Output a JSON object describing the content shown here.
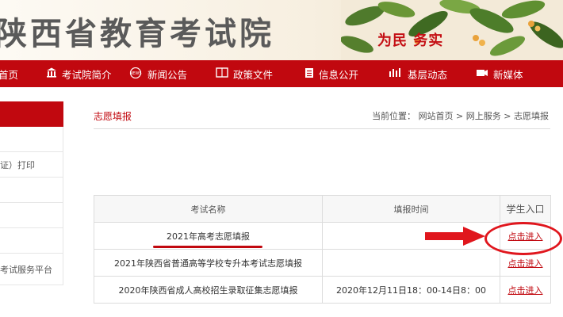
{
  "header": {
    "site_title": "陕西省教育考试院",
    "slogan": "为民  务实"
  },
  "nav": {
    "items": [
      {
        "label": "首页",
        "icon": "home-icon"
      },
      {
        "label": "考试院简介",
        "icon": "building-icon"
      },
      {
        "label": "新闻公告",
        "icon": "news-icon"
      },
      {
        "label": "政策文件",
        "icon": "book-icon"
      },
      {
        "label": "信息公开",
        "icon": "document-icon"
      },
      {
        "label": "基层动态",
        "icon": "activity-icon"
      },
      {
        "label": "新媒体",
        "icon": "camera-icon"
      }
    ]
  },
  "sidebar": {
    "items": [
      {
        "label": ""
      },
      {
        "label": "证）打印"
      },
      {
        "label": ""
      },
      {
        "label": ""
      },
      {
        "label": ""
      },
      {
        "label": "考试服务平台"
      }
    ]
  },
  "main": {
    "title": "志愿填报",
    "breadcrumb": {
      "prefix": "当前位置：",
      "items": [
        "网站首页",
        "网上服务",
        "志愿填报"
      ],
      "separator": " > "
    }
  },
  "table": {
    "headers": [
      "考试名称",
      "填报时间",
      "学生入口"
    ],
    "rows": [
      {
        "name": "2021年高考志愿填报",
        "time": "",
        "entry": "点击进入"
      },
      {
        "name": "2021年陕西省普通高等学校专升本考试志愿填报",
        "time": "",
        "entry": "点击进入"
      },
      {
        "name": "2020年陕西省成人高校招生录取征集志愿填报",
        "time": "2020年12月11日18：00-14日8：00",
        "entry": "点击进入"
      }
    ]
  },
  "colors": {
    "brand_red": "#c1080f",
    "annotation_red": "#e0161d"
  }
}
